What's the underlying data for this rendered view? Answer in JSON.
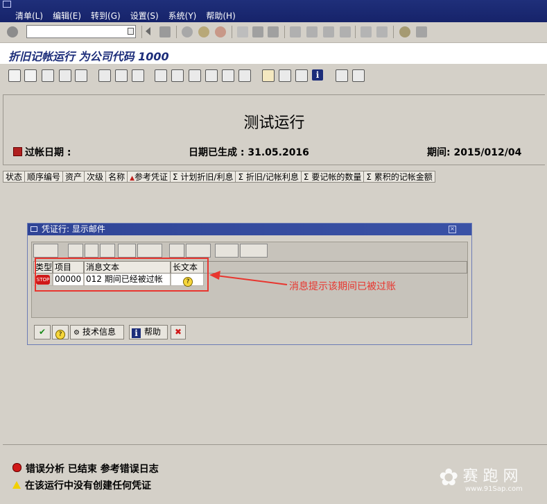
{
  "menu": {
    "items": [
      "清单(L)",
      "编辑(E)",
      "转到(G)",
      "设置(S)",
      "系统(Y)",
      "帮助(H)"
    ]
  },
  "toolbar": {
    "command_field_value": "",
    "std_icons": [
      "enter-icon",
      "back-icon",
      "exit-icon",
      "cancel-icon",
      "print-icon",
      "find-icon",
      "find-next-icon",
      "first-page-icon",
      "prev-page-icon",
      "next-page-icon",
      "last-page-icon",
      "new-session-icon",
      "shortcut-icon",
      "help-icon",
      "layout-icon"
    ],
    "app_icons": [
      "choose-detail-icon",
      "display-icon",
      "print-icon",
      "filter-sort-ascending-icon",
      "filter-icon",
      "sum-icon",
      "subtotal-icon",
      "export-icon",
      "change-layout-icon",
      "select-layout-icon",
      "save-layout-icon",
      "word-processing-icon",
      "spreadsheet-icon",
      "graphic-icon",
      "abc-analysis-icon",
      "grid-icon",
      "insert-row-icon",
      "delete-row-icon",
      "info-icon",
      "display-log-icon",
      "display-errors-icon"
    ]
  },
  "page": {
    "title": "折旧记帐运行 为公司代码 1000"
  },
  "report": {
    "title": "测试运行",
    "posting_date_label": "过帐日期 :",
    "generated_label": "日期已生成 : 31.05.2016",
    "period_label": "期间: 2015/012/04"
  },
  "columns": [
    "状态",
    "顺序编号",
    "资产",
    "次级",
    "名称",
    "参考凭证",
    "Σ 计划折旧/利息",
    "Σ 折旧/记帐利息",
    "Σ 要记帐的数量",
    "Σ 累积的记帐金额"
  ],
  "dialog": {
    "title": "凭证行: 显示邮件",
    "table_headers": [
      "类型",
      "项目",
      "消息文本",
      "长文本"
    ],
    "rows": [
      {
        "type": "STOP",
        "item": "00000",
        "text": "012 期间已经被过帐"
      }
    ],
    "buttons": {
      "technical_info": "技术信息",
      "help": "帮助"
    }
  },
  "annotation": {
    "text": "消息提示该期间已被过账"
  },
  "status": {
    "line1": "错误分析 已结束 参考错误日志",
    "line2": "在该运行中没有创建任何凭证"
  },
  "watermark": {
    "text": "赛 跑 网",
    "url": "www.91Sap.com"
  },
  "colors": {
    "menubar": "#1f2f7a",
    "title_text": "#1c2d7a",
    "annotation": "#e8352e"
  }
}
